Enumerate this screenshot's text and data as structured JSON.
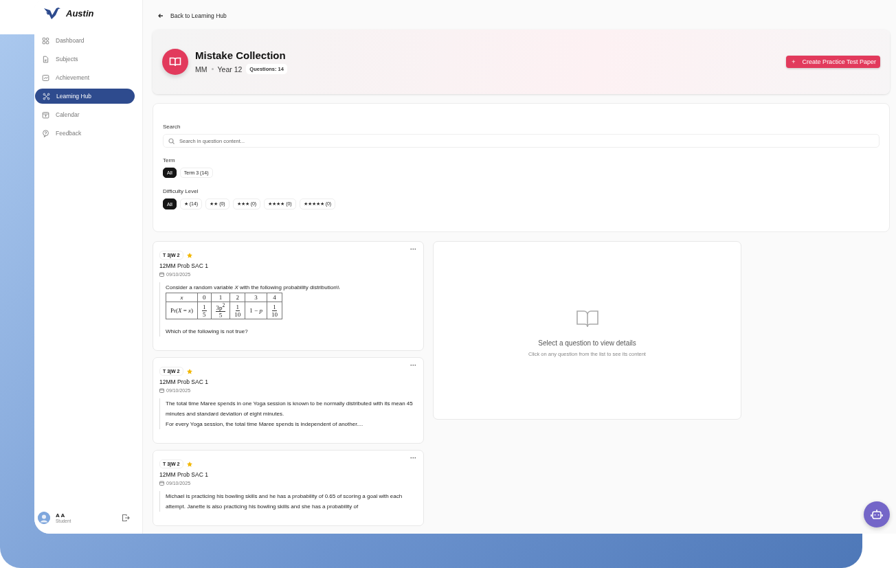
{
  "app": {
    "name": "Austin"
  },
  "sidebar": {
    "items": [
      {
        "label": "Dashboard",
        "selected": false
      },
      {
        "label": "Subjects",
        "selected": false
      },
      {
        "label": "Achievement",
        "selected": false
      },
      {
        "label": "Learning Hub",
        "selected": true
      },
      {
        "label": "Calendar",
        "selected": false
      },
      {
        "label": "Feedback",
        "selected": false
      }
    ],
    "user": {
      "name": "A A",
      "role": "Student"
    }
  },
  "back_link": "Back to Learning Hub",
  "header": {
    "title": "Mistake Collection",
    "subject": "MM",
    "year": "Year 12",
    "questions_badge": "Questions: 14",
    "create_button": "Create Practice Test Paper",
    "create_icon": "+"
  },
  "filters": {
    "search_label": "Search",
    "search": {
      "placeholder": "Search in question content..."
    },
    "term_label": "Term",
    "terms": [
      {
        "label": "All",
        "selected": true
      },
      {
        "label": "Term 3 (14)",
        "selected": false
      }
    ],
    "difficulty_label": "Difficulty Level",
    "difficulties": [
      {
        "label": "All",
        "selected": true
      },
      {
        "label": "★ (14)",
        "selected": false
      },
      {
        "label": "★★ (0)",
        "selected": false
      },
      {
        "label": "★★★ (0)",
        "selected": false
      },
      {
        "label": "★★★★ (0)",
        "selected": false
      },
      {
        "label": "★★★★★ (0)",
        "selected": false
      }
    ]
  },
  "questions": [
    {
      "tag": "T 3|W 2",
      "title": "12MM Prob SAC 1",
      "date": "09/10/2025",
      "menu": "···",
      "paragraphs": [
        "Consider a random variable *X* with the following probability distribution\\\\"
      ],
      "table": {
        "rows": [
          [
            {
              "text": "*x*"
            },
            {
              "text": "0"
            },
            {
              "text": "1"
            },
            {
              "text": "2"
            },
            {
              "text": "3"
            },
            {
              "text": "4"
            }
          ],
          [
            {
              "text": "Pr(*X* = *x*)"
            },
            {
              "num": "1",
              "den": "5"
            },
            {
              "num": "3p$^{2}$",
              "den": "5"
            },
            {
              "num": "1",
              "den": "10"
            },
            {
              "text": "1 − *p*"
            },
            {
              "num": "1",
              "den": "10"
            }
          ]
        ]
      },
      "after": [
        "Which of the following is not true?"
      ]
    },
    {
      "tag": "T 3|W 2",
      "title": "12MM Prob SAC 1",
      "date": "09/10/2025",
      "menu": "···",
      "paragraphs": [
        "The total time Maree spends in one Yoga session is known to be normally distributed with its mean 45 minutes and standard deviation of eight minutes.",
        "For every Yoga session, the total time Maree spends is independent of another...."
      ]
    },
    {
      "tag": "T 3|W 2",
      "title": "12MM Prob SAC 1",
      "date": "09/10/2025",
      "menu": "···",
      "paragraphs": [
        "Michael is practicing his bowling skills and he has a probability of 0.65 of scoring a goal with each attempt. Janette is also practicing his bowling skills and she has a probability of"
      ]
    }
  ],
  "detail": {
    "title": "Select a question to view details",
    "hint": "Click on any question from the list to see its content"
  }
}
